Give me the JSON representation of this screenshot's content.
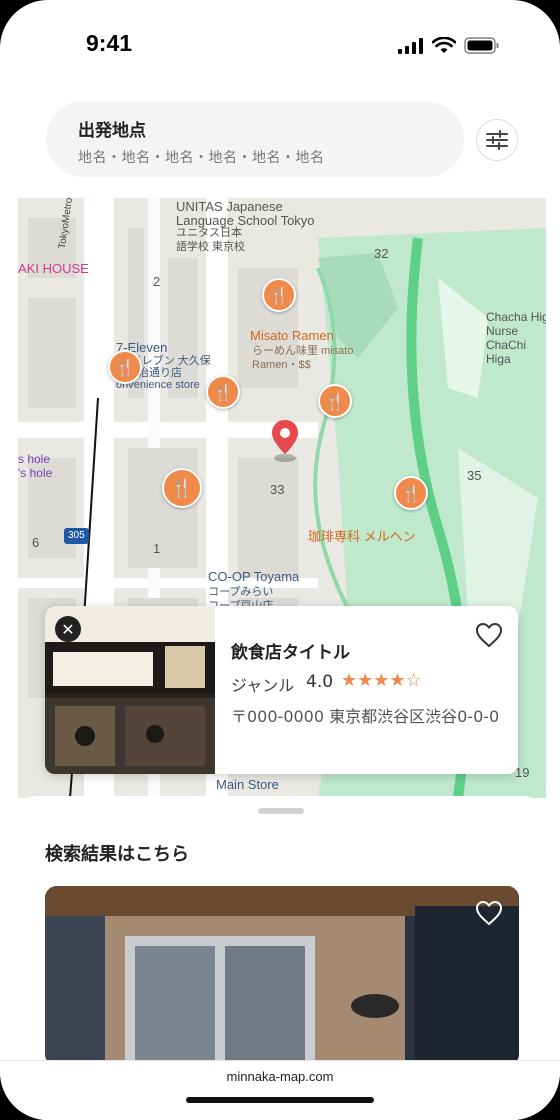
{
  "status_bar": {
    "time": "9:41"
  },
  "search": {
    "title": "出発地点",
    "subtitle": "地名・地名・地名・地名・地名・地名"
  },
  "map": {
    "labels": {
      "unitas": "UNITAS Japanese\nLanguage School Tokyo",
      "unitas_jp": "ユニタス日本\n語学校 東京校",
      "aki_house": "AKI HOUSE",
      "misato": "Misato Ramen",
      "misato_jp": "らーめん味里 misato\nRamen・$$",
      "seven": "7-Eleven",
      "seven_jp": "ン-イレブン 大久保\n目明治通り店\nonvenience store",
      "chacha": "Chacha Higas\nNurse\nChaChi\nHiga",
      "s_hole": "s hole\n's hole",
      "coffee": "珈琲専科 メルヘン",
      "coop": "CO-OP Toyama",
      "coop_jp": "コープみらい\nコープ戸山店",
      "main_store": "Main Store",
      "tokyo_metro": "TokyoMetroFukutos",
      "route": "305",
      "numbers": [
        "2",
        "32",
        "35",
        "33",
        "1",
        "6",
        "19"
      ]
    }
  },
  "card": {
    "title": "飲食店タイトル",
    "genre": "ジャンル",
    "rating": "4.0",
    "stars": "★★★★☆",
    "address": "〒000-0000 東京都渋谷区渋谷0-0-0"
  },
  "results": {
    "heading": "検索結果はこちら"
  },
  "browser": {
    "url": "minnaka-map.com"
  },
  "colors": {
    "accent": "#f08a4b",
    "pin_red": "#e5484d",
    "park": "#b8e6c8"
  }
}
